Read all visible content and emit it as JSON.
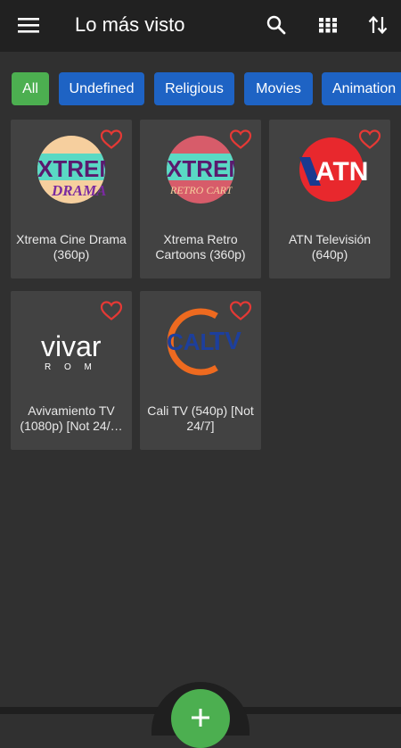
{
  "header": {
    "title": "Lo más visto",
    "menu_icon": "hamburger-menu-icon",
    "actions": [
      "search-icon",
      "grid-view-icon",
      "sort-icon"
    ]
  },
  "filters": {
    "chips": [
      {
        "label": "All",
        "active": true
      },
      {
        "label": "Undefined",
        "active": false
      },
      {
        "label": "Religious",
        "active": false
      },
      {
        "label": "Movies",
        "active": false
      },
      {
        "label": "Animation",
        "active": false
      }
    ]
  },
  "channels": [
    {
      "name": "Xtrema Cine Drama (360p)",
      "logo": "xtrema-cine-drama-logo",
      "logo_text_top": "XTREM",
      "logo_text_bottom": "DRAMA"
    },
    {
      "name": "Xtrema Retro Cartoons (360p)",
      "logo": "xtrema-retro-cartoons-logo",
      "logo_text_top": "XTREM",
      "logo_text_bottom": "RETRO CARTOONS"
    },
    {
      "name": "ATN Televisión (640p)",
      "logo": "atn-logo",
      "logo_text_top": "ATN"
    },
    {
      "name": "Avivamiento TV (1080p) [Not 24/…",
      "logo": "avivamiento-logo",
      "logo_text_top": "vivar",
      "logo_text_bottom": "R O M"
    },
    {
      "name": "Cali TV (540p) [Not 24/7]",
      "logo": "cali-tv-logo",
      "logo_text_top": "CALI",
      "logo_text_tv": "TV"
    }
  ],
  "colors": {
    "background": "#303030",
    "appbar": "#212121",
    "card": "#424242",
    "chip": "#1e63c4",
    "chip_active": "#4caf50",
    "favorite": "#e53935",
    "fab": "#4caf50"
  },
  "fab": {
    "icon": "add-icon"
  }
}
